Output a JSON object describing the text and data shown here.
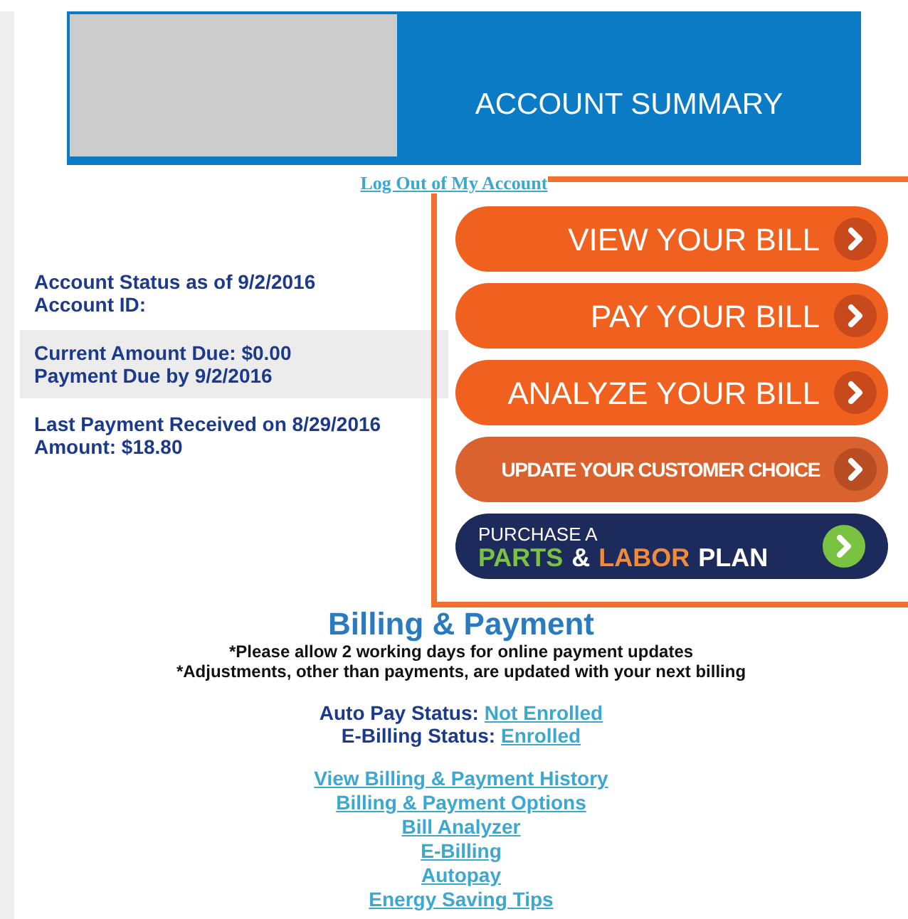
{
  "banner": {
    "title": "ACCOUNT SUMMARY"
  },
  "logout_link": "Log Out of My Account",
  "account": [
    {
      "lines": [
        "Account Status as of 9/2/2016",
        "Account ID:"
      ],
      "shaded": false
    },
    {
      "lines": [
        "Current Amount Due: $0.00",
        "Payment Due by 9/2/2016"
      ],
      "shaded": true
    },
    {
      "lines": [
        "Last Payment Received on 8/29/2016",
        "Amount: $18.80"
      ],
      "shaded": false
    }
  ],
  "actions": [
    {
      "kind": "orange",
      "label": "VIEW YOUR BILL"
    },
    {
      "kind": "orange",
      "label": "PAY YOUR BILL"
    },
    {
      "kind": "orange",
      "label": "ANALYZE YOUR BILL"
    },
    {
      "kind": "muted",
      "label": "UPDATE YOUR CUSTOMER CHOICE"
    },
    {
      "kind": "promo",
      "label": "PURCHASE A",
      "words": [
        {
          "text": "PARTS",
          "color": "#7cc242"
        },
        {
          "text": "&",
          "color": "#ffffff"
        },
        {
          "text": "LABOR",
          "color": "#f08a3c"
        },
        {
          "text": "PLAN",
          "color": "#ffffff"
        }
      ]
    }
  ],
  "billing": {
    "title": "Billing & Payment",
    "notes": [
      "*Please allow 2 working days for online payment updates",
      "*Adjustments, other than payments, are updated with your next billing"
    ],
    "statuses": [
      {
        "label": "Auto Pay Status:",
        "value": "Not Enrolled"
      },
      {
        "label": "E-Billing Status:",
        "value": "Enrolled"
      }
    ],
    "links": [
      "View Billing & Payment History",
      "Billing & Payment Options",
      "Bill Analyzer",
      "E-Billing",
      "Autopay",
      "Energy Saving Tips"
    ]
  }
}
